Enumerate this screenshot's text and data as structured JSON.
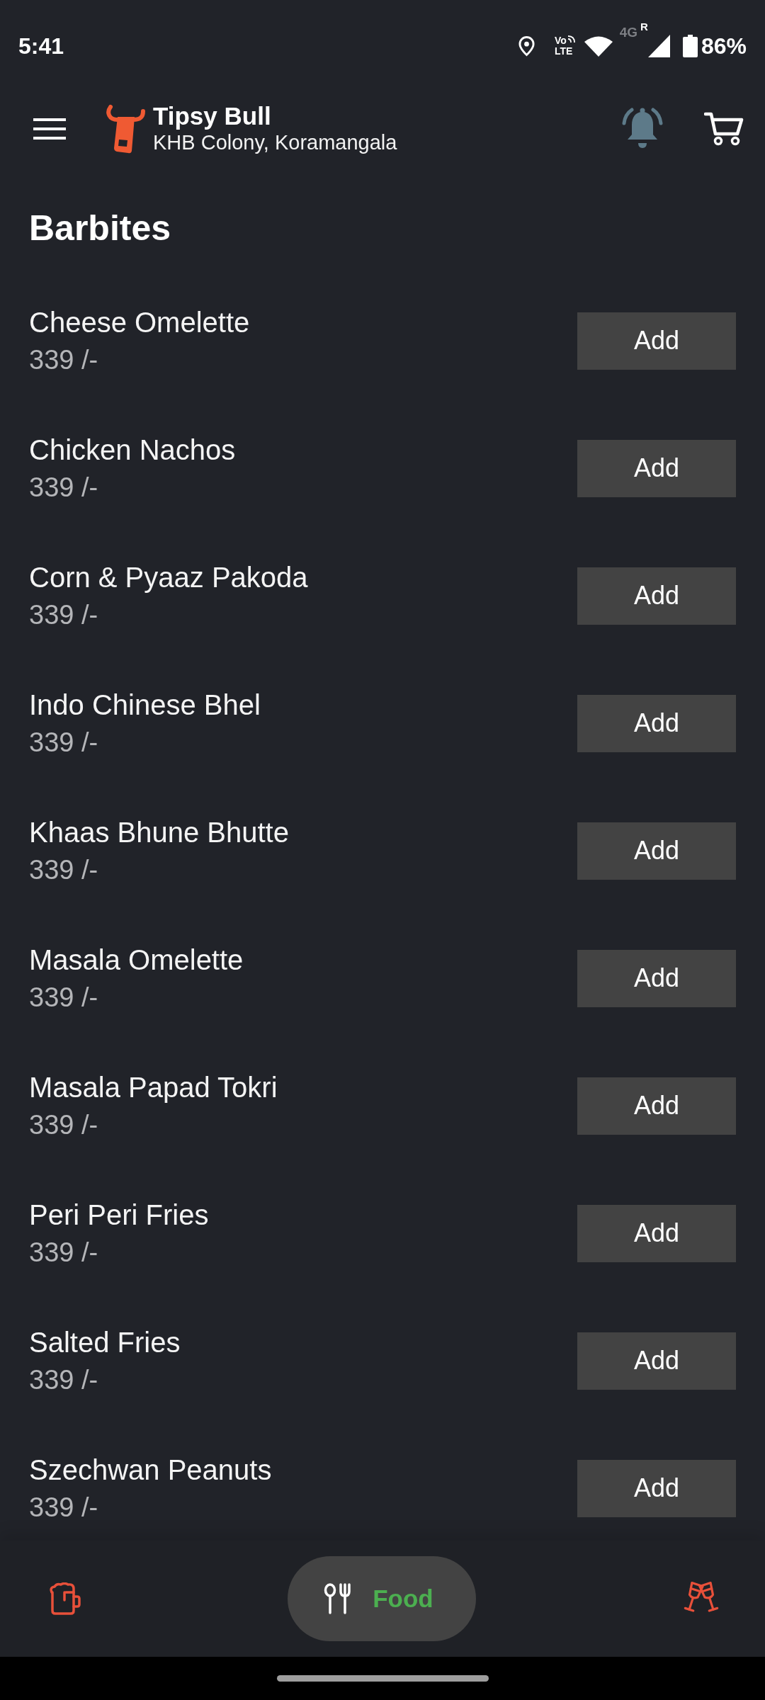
{
  "status_bar": {
    "time": "5:41",
    "volte_top": "Vo",
    "volte_bottom": "LTE",
    "network": "4G",
    "roaming": "R",
    "battery": "86%"
  },
  "header": {
    "title": "Tipsy Bull",
    "subtitle": "KHB Colony, Koramangala"
  },
  "section": {
    "title": "Barbites"
  },
  "items": [
    {
      "name": "Cheese Omelette",
      "price": "339 /-",
      "button": "Add"
    },
    {
      "name": "Chicken Nachos",
      "price": "339 /-",
      "button": "Add"
    },
    {
      "name": "Corn & Pyaaz Pakoda",
      "price": "339 /-",
      "button": "Add"
    },
    {
      "name": "Indo Chinese Bhel",
      "price": "339 /-",
      "button": "Add"
    },
    {
      "name": "Khaas Bhune Bhutte",
      "price": "339 /-",
      "button": "Add"
    },
    {
      "name": "Masala Omelette",
      "price": "339 /-",
      "button": "Add"
    },
    {
      "name": "Masala Papad Tokri",
      "price": "339 /-",
      "button": "Add"
    },
    {
      "name": "Peri Peri Fries",
      "price": "339 /-",
      "button": "Add"
    },
    {
      "name": "Salted Fries",
      "price": "339 /-",
      "button": "Add"
    },
    {
      "name": "Szechwan Peanuts",
      "price": "339 /-",
      "button": "Add"
    }
  ],
  "bottom_nav": [
    {
      "selected": false
    },
    {
      "label": "Food",
      "selected": true
    },
    {
      "selected": false
    }
  ]
}
